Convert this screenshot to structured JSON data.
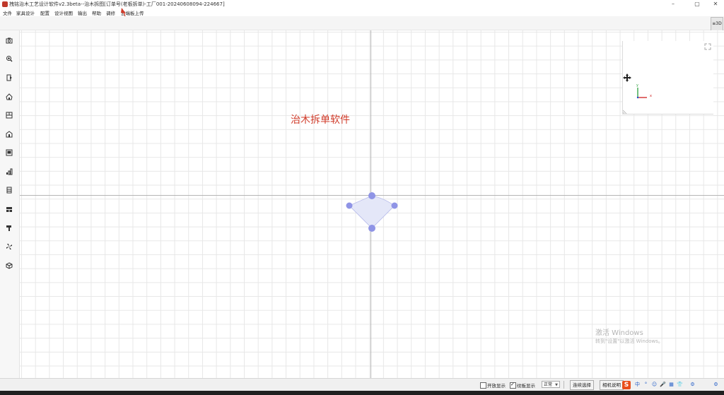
{
  "window": {
    "title": "拽铭治木工艺设计软件v2.3beta--治木拆图[订单号(老板拆单)-工厂001-20240608094-224667]",
    "minimize": "–",
    "maximize": "▢",
    "close": "✕"
  },
  "menu": [
    "文件",
    "家具设计",
    "配置",
    "设计视图",
    "输出",
    "帮助",
    "调修",
    "云端板上传"
  ],
  "view_toggle": "≡3D",
  "sidebar_icons": [
    "camera-icon",
    "zoom-icon",
    "door-icon",
    "home-icon",
    "layout-icon",
    "house-icon",
    "panel-icon",
    "bars-icon",
    "cabinet-icon",
    "drawer-icon",
    "hammer-icon",
    "fan-icon",
    "cube-icon"
  ],
  "canvas": {
    "overlay_text": "治木拆单软件"
  },
  "minimap": {
    "axis_x": "x",
    "axis_y": "y"
  },
  "watermark": {
    "title": "激活 Windows",
    "subtitle": "转到\"设置\"以激活 Windows。"
  },
  "statusbar": {
    "checkbox1_label": "开放显示",
    "checkbox2_label": "纹板显示",
    "select_value": "正常",
    "button1": "连续选择",
    "button2": "相机说明",
    "ime_items": [
      "中",
      "°",
      "☺",
      "🎤",
      "▦",
      "👕",
      "⚙",
      "⚙"
    ]
  },
  "colors": {
    "overlay_text": "#d03b2a",
    "shape_fill": "#e4e7f8",
    "shape_point": "#8f94e6",
    "grid": "#e7e7e7",
    "axis": "#b5b5b5"
  }
}
